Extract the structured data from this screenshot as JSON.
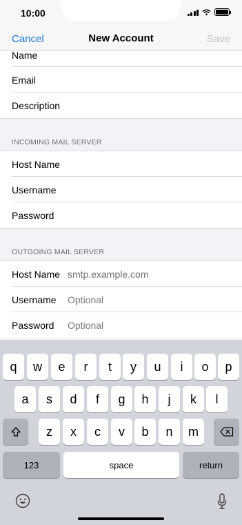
{
  "status_bar": {
    "time": "10:00"
  },
  "nav": {
    "cancel_label": "Cancel",
    "title": "New Account",
    "save_label": "Save"
  },
  "form": {
    "account_rows": [
      {
        "label": "Name"
      },
      {
        "label": "Email"
      },
      {
        "label": "Description"
      }
    ],
    "incoming": {
      "header": "INCOMING MAIL SERVER",
      "rows": [
        {
          "label": "Host Name"
        },
        {
          "label": "Username"
        },
        {
          "label": "Password"
        }
      ]
    },
    "outgoing": {
      "header": "OUTGOING MAIL SERVER",
      "rows": [
        {
          "label": "Host Name",
          "value": "smtp.example.com"
        },
        {
          "label": "Username",
          "placeholder": "Optional"
        },
        {
          "label": "Password",
          "placeholder": "Optional"
        }
      ]
    }
  },
  "keyboard": {
    "row1": [
      "q",
      "w",
      "e",
      "r",
      "t",
      "y",
      "u",
      "i",
      "o",
      "p"
    ],
    "row2": [
      "a",
      "s",
      "d",
      "f",
      "g",
      "h",
      "j",
      "k",
      "l"
    ],
    "row3": [
      "z",
      "x",
      "c",
      "v",
      "b",
      "n",
      "m"
    ],
    "numbers_label": "123",
    "space_label": "space",
    "return_label": "return",
    "icons": {
      "shift": "shift-icon",
      "delete": "delete-icon",
      "emoji": "emoji-icon",
      "mic": "microphone-icon"
    }
  }
}
